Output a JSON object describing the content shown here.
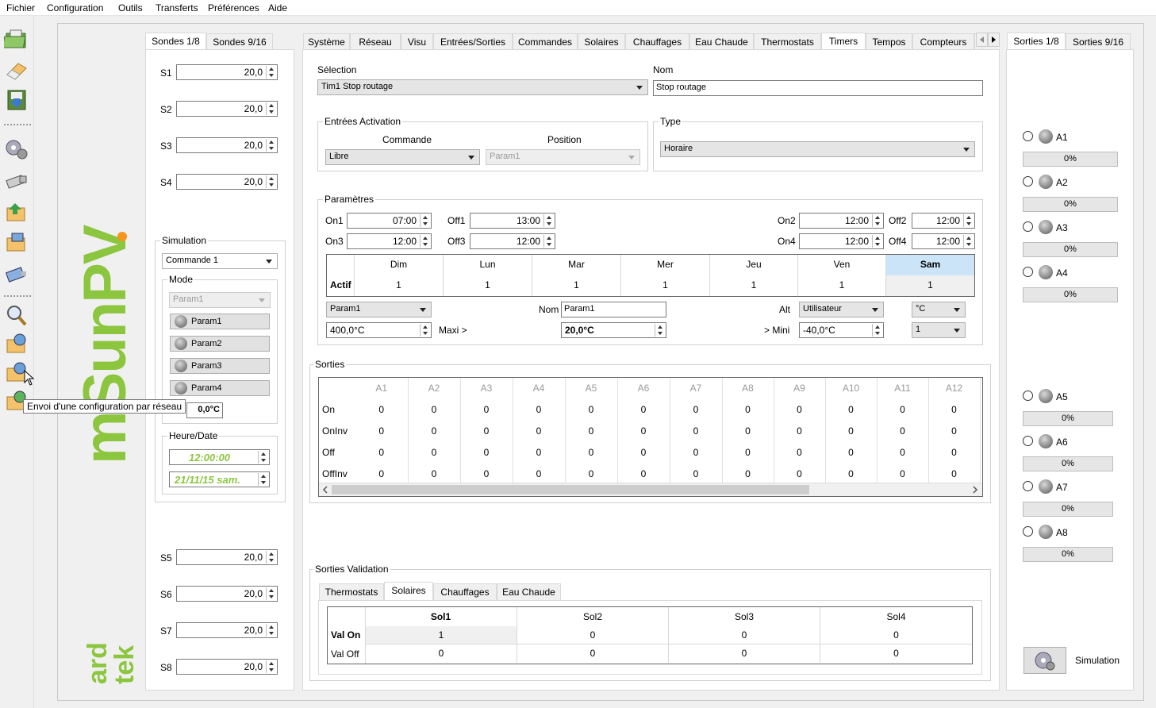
{
  "menu": [
    "Fichier",
    "Configuration",
    "Outils",
    "Transferts",
    "Préférences",
    "Aide"
  ],
  "tooltip": "Envoi d'une configuration par réseau",
  "logo": {
    "main": "mSunPV",
    "sub": "ard tek"
  },
  "left_tabs": [
    "Sondes 1/8",
    "Sondes 9/16"
  ],
  "sondes_top": [
    {
      "label": "S1",
      "value": "20,0"
    },
    {
      "label": "S2",
      "value": "20,0"
    },
    {
      "label": "S3",
      "value": "20,0"
    },
    {
      "label": "S4",
      "value": "20,0"
    }
  ],
  "sondes_bottom": [
    {
      "label": "S5",
      "value": "20,0"
    },
    {
      "label": "S6",
      "value": "20,0"
    },
    {
      "label": "S7",
      "value": "20,0"
    },
    {
      "label": "S8",
      "value": "20,0"
    }
  ],
  "simulation": {
    "title": "Simulation",
    "commande": "Commande 1",
    "mode_title": "Mode",
    "mode_select": "Param1",
    "params": [
      "Param1",
      "Param2",
      "Param3",
      "Param4"
    ],
    "value": "0,0°C",
    "heure_title": "Heure/Date",
    "heure": "12:00:00",
    "date": "21/11/15 sam."
  },
  "main_tabs": [
    "Système",
    "Réseau",
    "Visu",
    "Entrées/Sorties",
    "Commandes",
    "Solaires",
    "Chauffages",
    "Eau Chaude",
    "Thermostats",
    "Timers",
    "Tempos",
    "Compteurs"
  ],
  "main_tabs_active": 9,
  "selection": {
    "label": "Sélection",
    "value": "Tim1 Stop routage",
    "nom_label": "Nom",
    "nom_value": "Stop routage"
  },
  "entrees": {
    "title": "Entrées Activation",
    "commande_label": "Commande",
    "position_label": "Position",
    "commande_value": "Libre",
    "position_value": "Param1"
  },
  "type": {
    "title": "Type",
    "value": "Horaire"
  },
  "parametres": {
    "title": "Paramètres",
    "on1": {
      "label": "On1",
      "value": "07:00"
    },
    "off1": {
      "label": "Off1",
      "value": "13:00"
    },
    "on2": {
      "label": "On2",
      "value": "12:00"
    },
    "off2": {
      "label": "Off2",
      "value": "12:00"
    },
    "on3": {
      "label": "On3",
      "value": "12:00"
    },
    "off3": {
      "label": "Off3",
      "value": "12:00"
    },
    "on4": {
      "label": "On4",
      "value": "12:00"
    },
    "off4": {
      "label": "Off4",
      "value": "12:00"
    },
    "days": [
      "Dim",
      "Lun",
      "Mar",
      "Mer",
      "Jeu",
      "Ven",
      "Sam"
    ],
    "row_label": "Actif",
    "actif": [
      "1",
      "1",
      "1",
      "1",
      "1",
      "1",
      "1"
    ],
    "param_select": "Param1",
    "nom_label": "Nom",
    "nom_value": "Param1",
    "alt_label": "Alt",
    "alt_value": "Utilisateur",
    "unit": "°C",
    "val1": "400,0°C",
    "maxi_label": "Maxi >",
    "maxi_value": "20,0°C",
    "mini_label": "> Mini",
    "mini_value": "-40,0°C",
    "count": "1"
  },
  "sorties": {
    "title": "Sorties",
    "cols": [
      "A1",
      "A2",
      "A3",
      "A4",
      "A5",
      "A6",
      "A7",
      "A8",
      "A9",
      "A10",
      "A11",
      "A12"
    ],
    "rows": [
      {
        "label": "On",
        "values": [
          "0",
          "0",
          "0",
          "0",
          "0",
          "0",
          "0",
          "0",
          "0",
          "0",
          "0",
          "0"
        ]
      },
      {
        "label": "OnInv",
        "values": [
          "0",
          "0",
          "0",
          "0",
          "0",
          "0",
          "0",
          "0",
          "0",
          "0",
          "0",
          "0"
        ]
      },
      {
        "label": "Off",
        "values": [
          "0",
          "0",
          "0",
          "0",
          "0",
          "0",
          "0",
          "0",
          "0",
          "0",
          "0",
          "0"
        ]
      },
      {
        "label": "OffInv",
        "values": [
          "0",
          "0",
          "0",
          "0",
          "0",
          "0",
          "0",
          "0",
          "0",
          "0",
          "0",
          "0"
        ]
      }
    ]
  },
  "validation": {
    "title": "Sorties Validation",
    "tabs": [
      "Thermostats",
      "Solaires",
      "Chauffages",
      "Eau Chaude"
    ],
    "active": 1,
    "cols": [
      "Sol1",
      "Sol2",
      "Sol3",
      "Sol4"
    ],
    "rows": [
      {
        "label": "Val On",
        "values": [
          "1",
          "0",
          "0",
          "0"
        ]
      },
      {
        "label": "Val Off",
        "values": [
          "0",
          "0",
          "0",
          "0"
        ]
      }
    ]
  },
  "right_tabs": [
    "Sorties 1/8",
    "Sorties 9/16"
  ],
  "outputs": [
    {
      "label": "A1",
      "value": "0%"
    },
    {
      "label": "A2",
      "value": "0%"
    },
    {
      "label": "A3",
      "value": "0%"
    },
    {
      "label": "A4",
      "value": "0%"
    },
    {
      "label": "A5",
      "value": "0%"
    },
    {
      "label": "A6",
      "value": "0%"
    },
    {
      "label": "A7",
      "value": "0%"
    },
    {
      "label": "A8",
      "value": "0%"
    }
  ],
  "right_sim_label": "Simulation",
  "colors": {
    "logo_green": "#8cc63f",
    "logo_orange": "#f7941d",
    "header_active": "#cce4f7",
    "date_green": "#8cc63f"
  }
}
